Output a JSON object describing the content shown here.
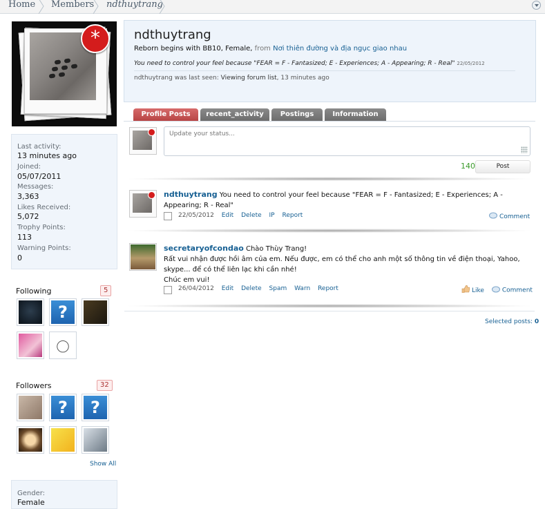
{
  "breadcrumb": {
    "items": [
      "Home",
      "Members",
      "ndthuytrang"
    ]
  },
  "profile": {
    "username": "ndthuytrang",
    "blurb_start": "Reborn begins with BB10, Female,",
    "from_word": "from",
    "location": "Nơi thiên đường và địa ngục giao nhau",
    "status": "You need to control your feel because \"FEAR = F - Fantasized; E - Experiences; A - Appearing; R - Real\"",
    "status_date": "22/05/2012",
    "last_seen_prefix": "ndthuytrang was last seen:",
    "last_seen_activity": "Viewing forum list",
    "last_seen_time": "13 minutes ago"
  },
  "stats": [
    {
      "label": "Last activity:",
      "value": "13 minutes ago"
    },
    {
      "label": "Joined:",
      "value": "05/07/2011"
    },
    {
      "label": "Messages:",
      "value": "3,363"
    },
    {
      "label": "Likes Received:",
      "value": "5,072"
    },
    {
      "label": "Trophy Points:",
      "value": "113"
    },
    {
      "label": "Warning Points:",
      "value": "0"
    }
  ],
  "following": {
    "label": "Following",
    "count": "5"
  },
  "followers": {
    "label": "Followers",
    "count": "32",
    "show_all": "Show All"
  },
  "about": {
    "gender_label": "Gender:",
    "gender_value": "Female"
  },
  "tabs": [
    "Profile Posts",
    "recent_activity",
    "Postings",
    "Information"
  ],
  "status_box": {
    "placeholder": "Update your status...",
    "counter": "140",
    "post_label": "Post"
  },
  "posts": [
    {
      "author": "ndthuytrang",
      "text": "You need to control your feel because \"FEAR = F - Fantasized; E - Experiences; A - Appearing; R - Real\"",
      "date": "22/05/2012",
      "links": [
        "Edit",
        "Delete",
        "IP",
        "Report"
      ],
      "comment": "Comment"
    },
    {
      "author": "secretaryofcondao",
      "line1": "Chào Thùy Trang!",
      "line2": "Rất vui nhận được hồi âm của em. Nếu được, em có thể cho anh một số thông tin về điện thoại, Yahoo,",
      "line3": "skype... để có thể liên lạc khi cần nhé!",
      "line4": "Chúc em vui!",
      "date": "26/04/2012",
      "links": [
        "Edit",
        "Delete",
        "Spam",
        "Warn",
        "Report"
      ],
      "like": "Like",
      "comment": "Comment"
    }
  ],
  "selected_posts": {
    "label": "Selected posts:",
    "count": "0"
  },
  "colors": {
    "active_tab": "#c54f4f",
    "tab": "#7b7b7b",
    "link": "#176093",
    "panel": "#eef4fb"
  }
}
